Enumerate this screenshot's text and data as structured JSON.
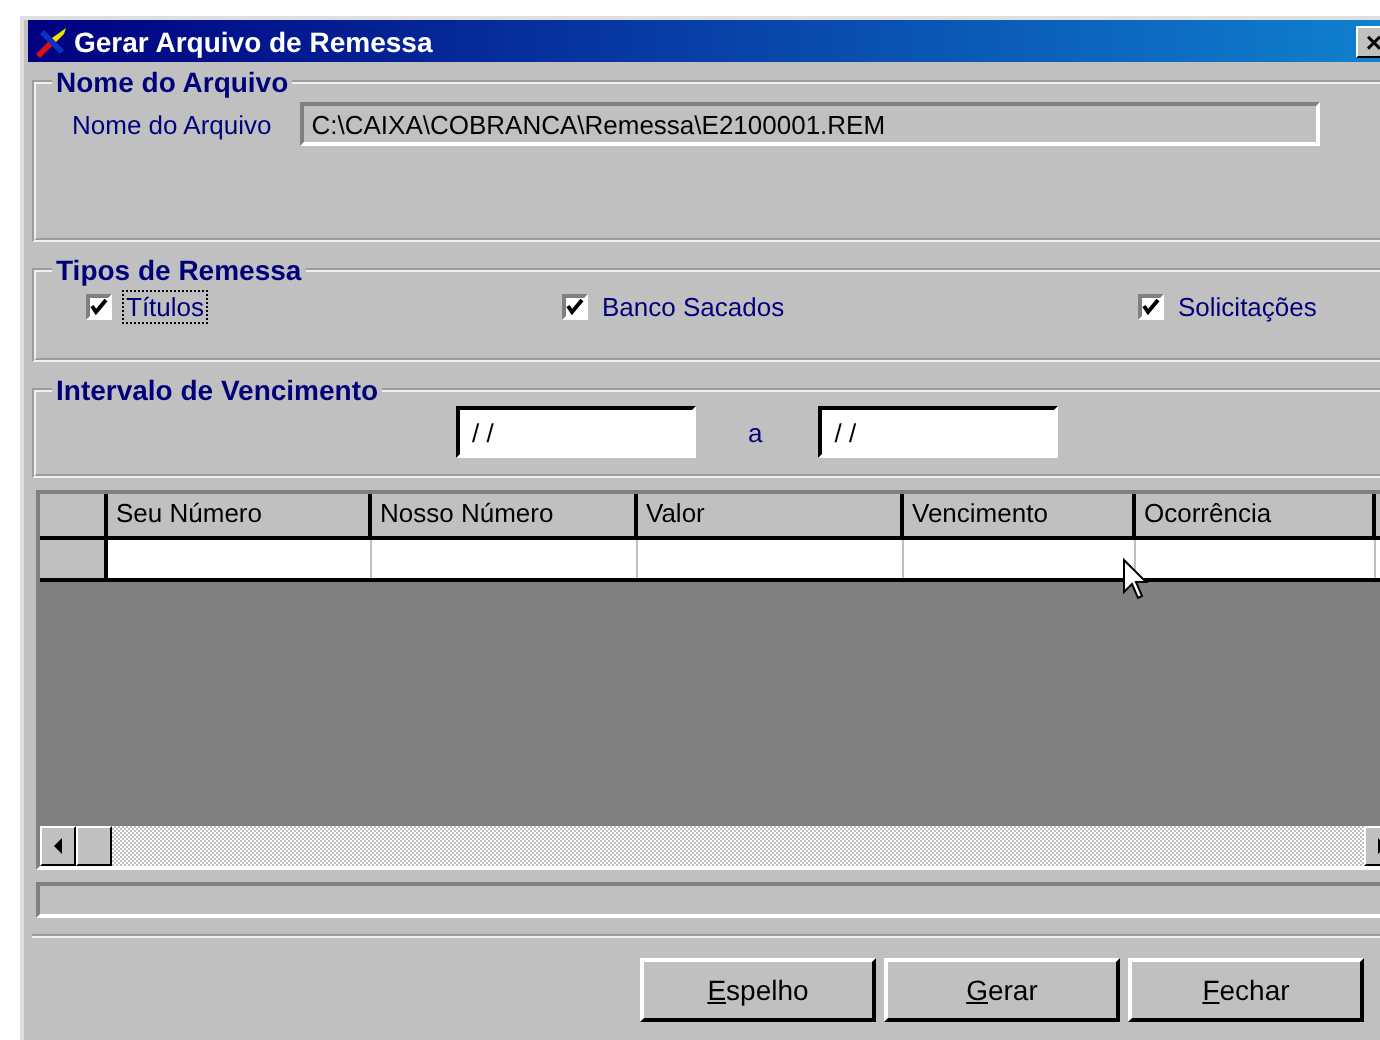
{
  "window": {
    "title": "Gerar Arquivo de Remessa",
    "close": "×"
  },
  "arquivo": {
    "legend": "Nome do Arquivo",
    "label": "Nome do Arquivo",
    "value": "C:\\CAIXA\\COBRANCA\\Remessa\\E2100001.REM"
  },
  "tipos": {
    "legend": "Tipos de Remessa",
    "options": [
      {
        "label": "Títulos",
        "checked": true,
        "focused": true
      },
      {
        "label": "Banco Sacados",
        "checked": true,
        "focused": false
      },
      {
        "label": "Solicitações",
        "checked": true,
        "focused": false
      }
    ]
  },
  "intervalo": {
    "legend": "Intervalo de Vencimento",
    "from": "/ /",
    "separator": "a",
    "to": "/ /"
  },
  "table": {
    "columns": [
      "Seu Número",
      "Nosso Número",
      "Valor",
      "Vencimento",
      "Ocorrência"
    ]
  },
  "buttons": [
    {
      "label": "Espelho"
    },
    {
      "label": "Gerar"
    },
    {
      "label": "Fechar"
    }
  ]
}
